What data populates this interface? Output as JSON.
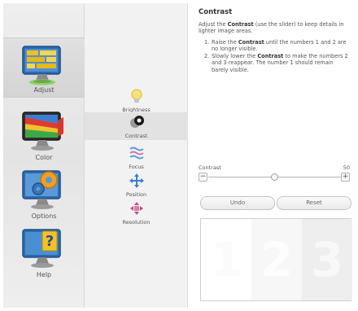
{
  "nav_main": [
    {
      "label": "Adjust",
      "icon": "monitor-adjust-icon",
      "selected": true
    },
    {
      "label": "Color",
      "icon": "monitor-color-icon",
      "selected": false
    },
    {
      "label": "Options",
      "icon": "monitor-options-icon",
      "selected": false
    },
    {
      "label": "Help",
      "icon": "monitor-help-icon",
      "selected": false
    }
  ],
  "nav_sub": [
    {
      "label": "Brightness",
      "icon": "brightness-icon",
      "selected": false
    },
    {
      "label": "Contrast",
      "icon": "contrast-icon",
      "selected": true
    },
    {
      "label": "Focus",
      "icon": "focus-icon",
      "selected": false
    },
    {
      "label": "Position",
      "icon": "position-icon",
      "selected": false
    },
    {
      "label": "Resolution",
      "icon": "resolution-icon",
      "selected": false
    }
  ],
  "content": {
    "title": "Contrast",
    "desc_pre": "Adjust the ",
    "desc_bold": "Contrast",
    "desc_post": " (use the slider) to keep details in lighter image areas.",
    "step1_pre": "Raise the ",
    "step1_bold": "Contrast",
    "step1_post": " until the numbers 1 and 2 are no longer visible.",
    "step2_pre": "Slowly lower the ",
    "step2_bold": "Contrast",
    "step2_post": " to make the numbers 2 and 3 reappear. The number 1 should remain barely visible.",
    "step1_num": "1.",
    "step2_num": "2.",
    "slider_label": "Contrast",
    "slider_value": "50",
    "slider_level": 0.5,
    "minus_symbol": "−",
    "plus_symbol": "+",
    "undo_label": "Undo",
    "reset_label": "Reset",
    "preview_digits": [
      "1",
      "2",
      "3"
    ]
  },
  "colors": {
    "nav_background": "#e8e8e8",
    "selected_background": "#d6d6d6",
    "text": "#555555"
  }
}
